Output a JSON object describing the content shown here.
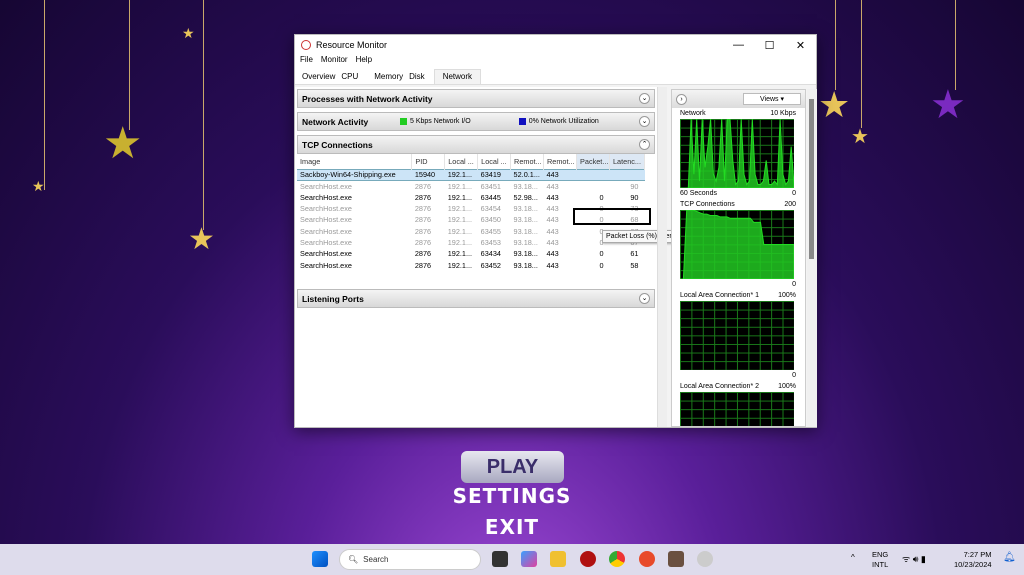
{
  "game": {
    "play": "PLAY",
    "settings": "SETTINGS",
    "exit": "EXIT"
  },
  "window": {
    "title": "Resource Monitor",
    "min": "—",
    "max": "☐",
    "close": "✕"
  },
  "menu": [
    "File",
    "Monitor",
    "Help"
  ],
  "tabs": [
    "Overview",
    "CPU",
    "Memory",
    "Disk",
    "Network"
  ],
  "sections": {
    "processes": "Processes with Network Activity",
    "activity": "Network Activity",
    "activity_io": "5 Kbps Network I/O",
    "activity_util": "0% Network Utilization",
    "tcp": "TCP Connections",
    "listening": "Listening Ports"
  },
  "colors": {
    "io": "#22cc22",
    "util": "#1010c0",
    "graph": "#22dd22"
  },
  "tcp": {
    "columns": [
      "Image",
      "PID",
      "Local ...",
      "Local ...",
      "Remot...",
      "Remot...",
      "Packet...",
      "Latenc..."
    ],
    "rows": [
      {
        "image": "Sackboy-Win64-Shipping.exe",
        "pid": "15940",
        "la": "192.1...",
        "lp": "63419",
        "ra": "52.0.1...",
        "rp": "443",
        "loss": "",
        "lat": "",
        "style": "sel"
      },
      {
        "image": "SearchHost.exe",
        "pid": "2876",
        "la": "192.1...",
        "lp": "63451",
        "ra": "93.18...",
        "rp": "443",
        "loss": "",
        "lat": "90",
        "style": "dim"
      },
      {
        "image": "SearchHost.exe",
        "pid": "2876",
        "la": "192.1...",
        "lp": "63445",
        "ra": "52.98...",
        "rp": "443",
        "loss": "0",
        "lat": "90",
        "style": ""
      },
      {
        "image": "SearchHost.exe",
        "pid": "2876",
        "la": "192.1...",
        "lp": "63454",
        "ra": "93.18...",
        "rp": "443",
        "loss": "0",
        "lat": "73",
        "style": "dim"
      },
      {
        "image": "SearchHost.exe",
        "pid": "2876",
        "la": "192.1...",
        "lp": "63450",
        "ra": "93.18...",
        "rp": "443",
        "loss": "0",
        "lat": "68",
        "style": "dim"
      },
      {
        "image": "SearchHost.exe",
        "pid": "2876",
        "la": "192.1...",
        "lp": "63455",
        "ra": "93.18...",
        "rp": "443",
        "loss": "0",
        "lat": "67",
        "style": "dim"
      },
      {
        "image": "SearchHost.exe",
        "pid": "2876",
        "la": "192.1...",
        "lp": "63453",
        "ra": "93.18...",
        "rp": "443",
        "loss": "0",
        "lat": "67",
        "style": "dim"
      },
      {
        "image": "SearchHost.exe",
        "pid": "2876",
        "la": "192.1...",
        "lp": "63434",
        "ra": "93.18...",
        "rp": "443",
        "loss": "0",
        "lat": "61",
        "style": ""
      },
      {
        "image": "SearchHost.exe",
        "pid": "2876",
        "la": "192.1...",
        "lp": "63452",
        "ra": "93.18...",
        "rp": "443",
        "loss": "0",
        "lat": "58",
        "style": ""
      }
    ]
  },
  "tooltip": "Packet Loss (%): Percent of packets lost",
  "right": {
    "views": "Views",
    "graphs": [
      {
        "title": "Network",
        "max": "10 Kbps",
        "foot_left": "60 Seconds",
        "foot_right": "0",
        "values": [
          0,
          0,
          0,
          0,
          100,
          20,
          100,
          10,
          100,
          30,
          60,
          100,
          20,
          10,
          30,
          100,
          10,
          100,
          100,
          40,
          5,
          10,
          100,
          20,
          5,
          10,
          100,
          20,
          5,
          5,
          10,
          40,
          5,
          5,
          10,
          5,
          100,
          20,
          5,
          10,
          60,
          5
        ]
      },
      {
        "title": "TCP Connections",
        "max": "200",
        "foot_left": "",
        "foot_right": "0",
        "values": [
          0,
          0,
          100,
          100,
          100,
          98,
          96,
          94,
          94,
          92,
          92,
          92,
          90,
          90,
          90,
          88,
          88,
          88,
          88,
          88,
          88,
          88,
          82,
          82,
          82,
          50,
          50,
          50,
          50,
          50,
          50,
          50,
          50,
          50,
          50
        ]
      },
      {
        "title": "Local Area Connection* 1",
        "max": "100%",
        "foot_left": "",
        "foot_right": "0",
        "values": []
      },
      {
        "title": "Local Area Connection* 2",
        "max": "100%",
        "foot_left": "",
        "foot_right": "",
        "values": []
      }
    ]
  },
  "taskbar": {
    "search": "Search",
    "lang1": "ENG",
    "lang2": "INTL",
    "time": "7:27 PM",
    "date": "10/23/2024"
  }
}
